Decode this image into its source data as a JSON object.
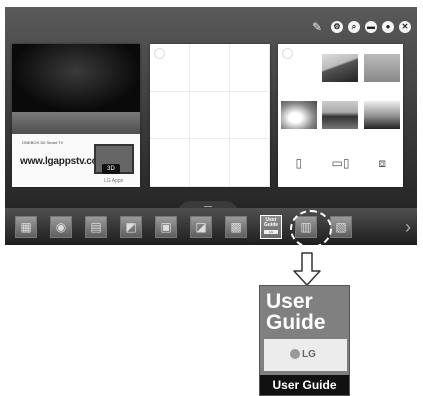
{
  "tv": {
    "top_icons": [
      "edit-icon",
      "settings-icon",
      "search-icon",
      "input-icon",
      "user-icon",
      "close-icon"
    ],
    "card1": {
      "small_text": "ONEBOX 3D Smart TV",
      "url_text": "www.lgappstv.com",
      "badge": "3D",
      "brand": "LG Apps"
    },
    "launcher": {
      "apps": [
        "app-1",
        "app-2",
        "app-3",
        "app-4",
        "app-5",
        "app-6",
        "app-7",
        "user-guide",
        "app-9",
        "app-10"
      ],
      "user_guide_line1": "User",
      "user_guide_line2": "Guide",
      "user_guide_mini": "LG"
    }
  },
  "zoom": {
    "title_line1": "User",
    "title_line2": "Guide",
    "logo": "LG",
    "caption": "User Guide"
  }
}
